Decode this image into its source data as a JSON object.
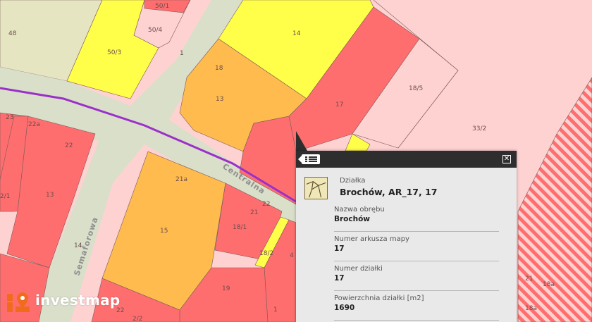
{
  "map": {
    "parcel_labels": [
      "48",
      "50/1",
      "50/4",
      "50/3",
      "14",
      "18",
      "13",
      "17",
      "18/5",
      "33/2",
      "23",
      "22a",
      "22",
      "2/1",
      "13",
      "21a",
      "22",
      "21",
      "18/1",
      "18/2",
      "15",
      "14",
      "19",
      "22",
      "1",
      "4",
      "21",
      "18a",
      "18a",
      "1",
      "2/2"
    ],
    "streets": {
      "centralna": "Centralna",
      "semaforowa": "Semaforowa"
    },
    "colors": {
      "yellow": "#ffff49",
      "orange": "#ffbb4e",
      "red": "#ff6e6e",
      "pink": "#ffd2d2",
      "beige": "#e6e5c2",
      "road": "#d9dfc9",
      "route": "#9b30c9"
    }
  },
  "popup": {
    "menu_icon": "list-icon",
    "close_icon": "close-icon",
    "object_type": "Działka",
    "title": "Brochów, AR_17, 17",
    "fields": [
      {
        "label": "Nazwa obrębu",
        "value": "Brochów"
      },
      {
        "label": "Numer arkusza mapy",
        "value": "17"
      },
      {
        "label": "Numer działki",
        "value": "17"
      },
      {
        "label": "Powierzchnia działki [m2]",
        "value": "1690"
      }
    ]
  },
  "brand": {
    "name": "investmap"
  }
}
